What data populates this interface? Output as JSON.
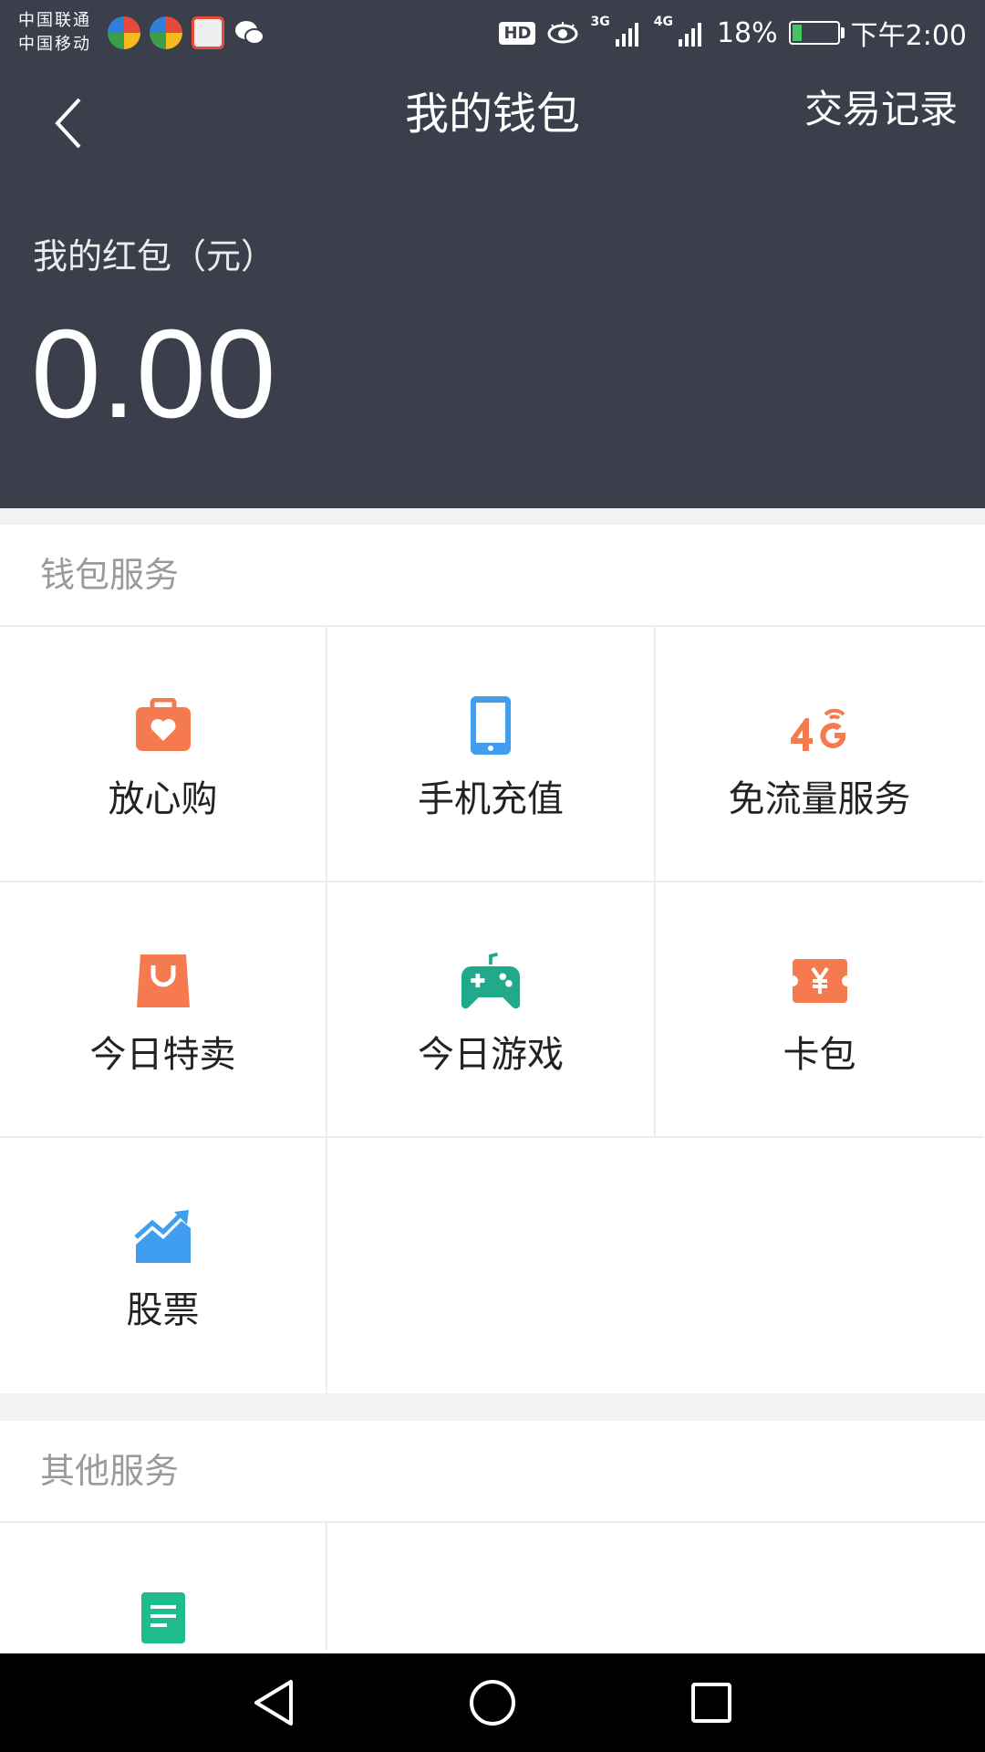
{
  "status_bar": {
    "carrier_1": "中国联通",
    "carrier_2": "中国移动",
    "hd": "HD",
    "sig1_type": "3G",
    "sig2_type": "4G",
    "battery": "18%",
    "time": "下午2:00"
  },
  "nav": {
    "title": "我的钱包",
    "action": "交易记录"
  },
  "wallet": {
    "label": "我的红包（元）",
    "amount": "0.00"
  },
  "wallet_services": {
    "title": "钱包服务",
    "items": [
      {
        "label": "放心购",
        "icon": "heart-bag-icon",
        "color": "#f57a50"
      },
      {
        "label": "手机充值",
        "icon": "mobile-phone-icon",
        "color": "#3f9ef0"
      },
      {
        "label": "免流量服务",
        "icon": "4g-icon",
        "color": "#f57a50"
      },
      {
        "label": "今日特卖",
        "icon": "shopping-bag-icon",
        "color": "#f57a50"
      },
      {
        "label": "今日游戏",
        "icon": "gamepad-icon",
        "color": "#20a98a"
      },
      {
        "label": "卡包",
        "icon": "yen-ticket-icon",
        "color": "#f57a50"
      },
      {
        "label": "股票",
        "icon": "stock-chart-icon",
        "color": "#3f9ef0"
      }
    ]
  },
  "other_services": {
    "title": "其他服务",
    "items": [
      {
        "label": "",
        "icon": "document-icon",
        "color": "#1ebc8c"
      }
    ]
  }
}
